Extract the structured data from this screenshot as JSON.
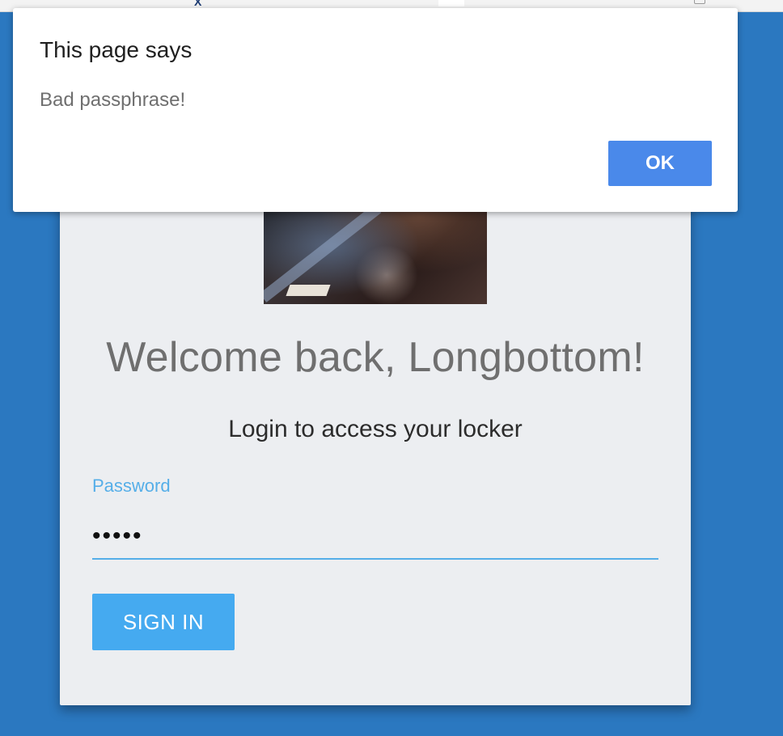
{
  "alert": {
    "title": "This page says",
    "message": "Bad passphrase!",
    "ok_label": "OK"
  },
  "login": {
    "welcome": "Welcome back, Longbottom!",
    "subtitle": "Login to access your locker",
    "password_label": "Password",
    "password_value": "•••••",
    "signin_label": "SIGN IN"
  },
  "colors": {
    "background": "#2b78c0",
    "card": "#eceef1",
    "accent": "#55aee8",
    "button": "#45aaf0",
    "ok_button": "#4a89ea"
  },
  "icons": {
    "browser_glyph": "X"
  }
}
